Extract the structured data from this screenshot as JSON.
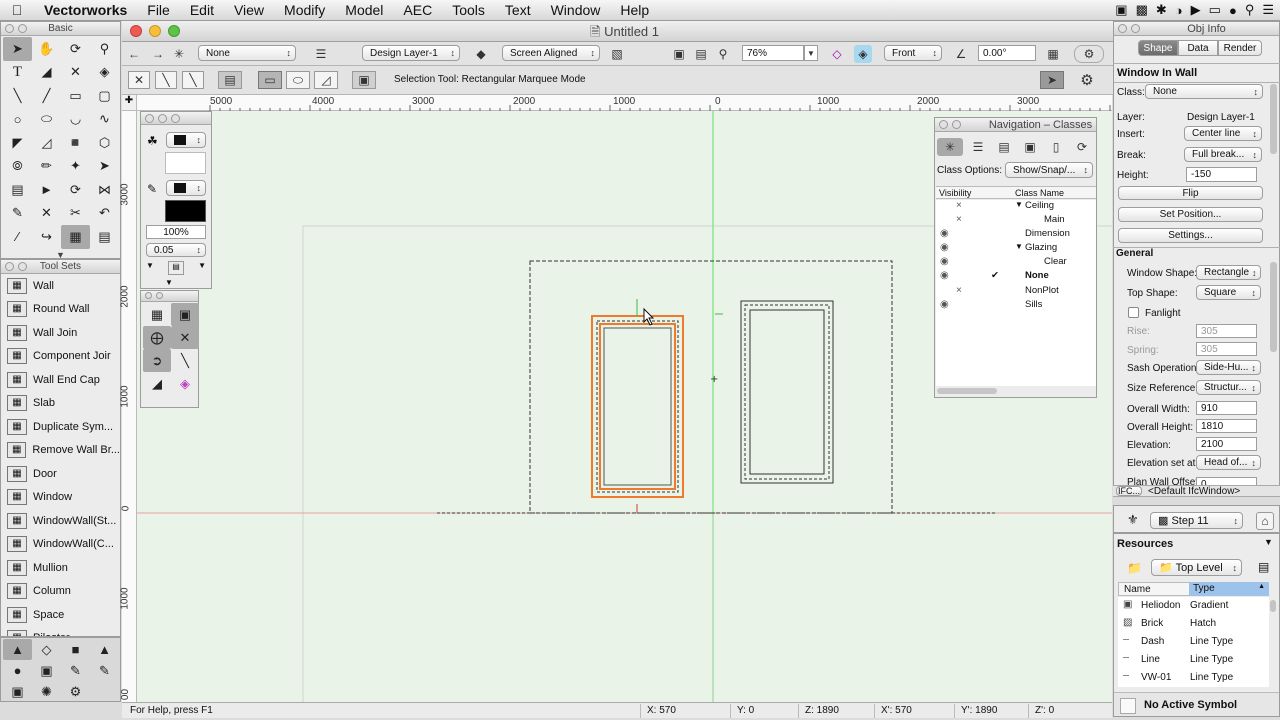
{
  "menubar": {
    "app": "Vectorworks",
    "items": [
      "File",
      "Edit",
      "View",
      "Modify",
      "Model",
      "AEC",
      "Tools",
      "Text",
      "Window",
      "Help"
    ]
  },
  "window": {
    "title": "Untitled 1"
  },
  "toolbar": {
    "class_popup": "None",
    "layer_popup": "Design Layer-1",
    "plane_popup": "Screen Aligned",
    "zoom_value": "76%",
    "view_popup": "Front",
    "angle_value": "0.00°"
  },
  "mode_bar": {
    "status": "Selection Tool: Rectangular Marquee Mode"
  },
  "basic_palette": {
    "title": "Basic"
  },
  "attributes": {
    "opacity": "100%",
    "line_weight": "0.05"
  },
  "toolsets": {
    "title": "Tool Sets",
    "items": [
      {
        "label": "Wall",
        "icon": "wall-icon"
      },
      {
        "label": "Round Wall",
        "icon": "round-wall-icon"
      },
      {
        "label": "Wall Join",
        "icon": "wall-join-icon"
      },
      {
        "label": "Component Joir",
        "icon": "component-join-icon"
      },
      {
        "label": "Wall End Cap",
        "icon": "wall-end-cap-icon"
      },
      {
        "label": "Slab",
        "icon": "slab-icon"
      },
      {
        "label": "Duplicate Sym...",
        "icon": "duplicate-symbol-icon"
      },
      {
        "label": "Remove Wall Br...",
        "icon": "remove-wall-break-icon"
      },
      {
        "label": "Door",
        "icon": "door-icon"
      },
      {
        "label": "Window",
        "icon": "window-icon"
      },
      {
        "label": "WindowWall(St...",
        "icon": "window-wall-icon"
      },
      {
        "label": "WindowWall(C...",
        "icon": "window-wall-icon"
      },
      {
        "label": "Mullion",
        "icon": "mullion-icon"
      },
      {
        "label": "Column",
        "icon": "column-icon"
      },
      {
        "label": "Space",
        "icon": "space-icon"
      },
      {
        "label": "Pilaster",
        "icon": "pilaster-icon"
      }
    ]
  },
  "rulers": {
    "h": [
      "5000",
      "4000",
      "3000",
      "2000",
      "1000",
      "0",
      "1000",
      "2000",
      "3000"
    ],
    "v": [
      "3000",
      "2000",
      "1000",
      "0",
      "1000",
      "00"
    ]
  },
  "navigation": {
    "title": "Navigation – Classes",
    "class_options_label": "Class Options:",
    "class_options_value": "Show/Snap/...",
    "col_visibility": "Visibility",
    "col_class_name": "Class Name",
    "rows": [
      {
        "name": "Ceiling",
        "vis": "×",
        "indent": 0,
        "tri": "▼"
      },
      {
        "name": "Main",
        "vis": "×",
        "indent": 1,
        "tri": ""
      },
      {
        "name": "Dimension",
        "vis": "eye",
        "indent": 0,
        "tri": ""
      },
      {
        "name": "Glazing",
        "vis": "eye",
        "indent": 0,
        "tri": "▼"
      },
      {
        "name": "Clear",
        "vis": "eye",
        "indent": 1,
        "tri": ""
      },
      {
        "name": "None",
        "vis": "eye",
        "indent": 0,
        "tri": "",
        "active": "✔"
      },
      {
        "name": "NonPlot",
        "vis": "×",
        "indent": 0,
        "tri": ""
      },
      {
        "name": "Sills",
        "vis": "eye",
        "indent": 0,
        "tri": ""
      }
    ]
  },
  "obj_info": {
    "title": "Obj Info",
    "tabs": [
      "Shape",
      "Data",
      "Render"
    ],
    "object": "Window In Wall",
    "class_label": "Class:",
    "class_value": "None",
    "layer_label": "Layer:",
    "layer_value": "Design Layer-1",
    "insert_label": "Insert:",
    "insert_value": "Center line",
    "break_label": "Break:",
    "break_value": "Full break...",
    "height_label": "Height:",
    "height_value": "-150",
    "flip_button": "Flip",
    "set_position_button": "Set Position...",
    "settings_button": "Settings...",
    "general_label": "General",
    "window_shape_label": "Window Shape:",
    "window_shape_value": "Rectangle",
    "top_shape_label": "Top Shape:",
    "top_shape_value": "Square",
    "fanlight_label": "Fanlight",
    "rise_label": "Rise:",
    "rise_value": "305",
    "spring_label": "Spring:",
    "spring_value": "305",
    "sash_label": "Sash Operation:",
    "sash_value": "Side-Hu...",
    "size_ref_label": "Size Reference:",
    "size_ref_value": "Structur...",
    "overall_width_label": "Overall Width:",
    "overall_width_value": "910",
    "overall_height_label": "Overall Height:",
    "overall_height_value": "1810",
    "elevation_label": "Elevation:",
    "elevation_value": "2100",
    "elevation_set_label": "Elevation set at:",
    "elevation_set_value": "Head of...",
    "plan_wall_offset_label": "Plan Wall Offset:",
    "plan_wall_offset_value": "0",
    "ifc_button": "IFC...",
    "ifc_text": "<Default IfcWindow>"
  },
  "undo": {
    "step": "Step 11"
  },
  "resources": {
    "title": "Resources",
    "scope": "Top Level",
    "col_name": "Name",
    "col_type": "Type",
    "rows": [
      {
        "name": "Heliodon",
        "type": "Gradient"
      },
      {
        "name": "Brick",
        "type": "Hatch"
      },
      {
        "name": "Dash",
        "type": "Line Type"
      },
      {
        "name": "Line",
        "type": "Line Type"
      },
      {
        "name": "VW-01",
        "type": "Line Type"
      }
    ],
    "no_symbol": "No Active Symbol"
  },
  "status": {
    "help": "For Help, press F1",
    "x": "X: 570",
    "y": "Y: 0",
    "z": "Z: 1890",
    "xp": "X': 570",
    "yp": "Y': 1890",
    "zp": "Z': 0"
  }
}
